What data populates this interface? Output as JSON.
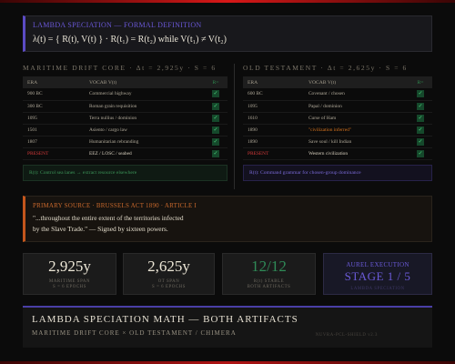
{
  "definition": {
    "title": "LAMBDA SPECIATION — FORMAL DEFINITION",
    "formula": "λ(t) = { R(t), V(t) } · R(t₁) = R(t₂) while V(t₁) ≠ V(t₂)"
  },
  "maritime": {
    "heading": "MARITIME DRIFT CORE · Δt = 2,925y · S = 6",
    "columns": [
      "ERA",
      "VOCAB V(t)",
      "R="
    ],
    "rows": [
      {
        "era": "900 BC",
        "vocab": "Commercial highway"
      },
      {
        "era": "300 BC",
        "vocab": "Roman grain requisition"
      },
      {
        "era": "1095",
        "vocab": "Terra nullius / dominion"
      },
      {
        "era": "1501",
        "vocab": "Asiento / cargo law"
      },
      {
        "era": "1807",
        "vocab": "Humanitarian rebranding"
      },
      {
        "era": "PRESENT",
        "vocab": "EEZ / LOSC / seabed"
      }
    ],
    "footer": "R(t): Control sea lanes → extract resource elsewhere"
  },
  "testament": {
    "heading": "OLD TESTAMENT · Δt = 2,625y · S = 6",
    "columns": [
      "ERA",
      "VOCAB V(t)",
      "R="
    ],
    "rows": [
      {
        "era": "600 BC",
        "vocab": "Covenant / chosen"
      },
      {
        "era": "1095",
        "vocab": "Papal / dominion"
      },
      {
        "era": "1610",
        "vocab": "Curse of Ham"
      },
      {
        "era": "1890",
        "vocab": "\"civilization inferred\""
      },
      {
        "era": "1890",
        "vocab": "Save soul / kill Indian"
      },
      {
        "era": "PRESENT",
        "vocab": "Western civilization"
      }
    ],
    "footer": "R(t): Command grammar for chosen-group dominance"
  },
  "source": {
    "title": "PRIMARY SOURCE · BRUSSELS ACT 1890 · ARTICLE I",
    "quote_line1": "\"...throughout the entire extent of the territories infected",
    "quote_line2": "by the Slave Trade.\" — Signed by sixteen powers."
  },
  "stats": [
    {
      "big": "2,925y",
      "sub1": "MARITIME SPAN",
      "sub2": "S = 6 EPOCHS"
    },
    {
      "big": "2,625y",
      "sub1": "OT SPAN",
      "sub2": "S = 6 EPOCHS"
    },
    {
      "big": "12/12",
      "sub1": "R(t) STABLE",
      "sub2": "BOTH ARTIFACTS"
    }
  ],
  "execution": {
    "line1": "AUREL EXECUTION",
    "line2": "STAGE 1 / 5",
    "line3": "LAMBDA SPECIATION"
  },
  "footer": {
    "title": "LAMBDA SPECIATION MATH — BOTH ARTIFACTS",
    "subtitle": "MARITIME DRIFT CORE × OLD TESTAMENT / CHIMERA",
    "version": "NUVRA-PCL-SHIELD v2.3"
  },
  "colors": {
    "accent_purple": "#5b4bc4",
    "accent_orange": "#c4561c",
    "check_green": "#4ad07a",
    "alert_red": "#d43a3a"
  },
  "icons": {
    "check": "check-icon"
  }
}
